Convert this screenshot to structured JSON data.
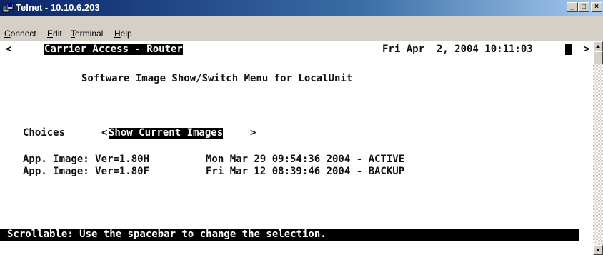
{
  "window": {
    "title": "Telnet - 10.10.6.203",
    "controls": {
      "minimize": "_",
      "maximize": "□",
      "close": "×"
    }
  },
  "menu": {
    "items": [
      {
        "label": "Connect",
        "underline": "C",
        "rest": "onnect"
      },
      {
        "label": "Edit",
        "underline": "E",
        "rest": "dit"
      },
      {
        "label": "Terminal",
        "underline": "T",
        "rest": "erminal"
      },
      {
        "label": "Help",
        "underline": "H",
        "rest": "elp"
      }
    ]
  },
  "terminal": {
    "left_arrow": "<",
    "right_arrow": ">",
    "header_title": "Carrier Access - Router",
    "datetime": "Fri Apr  2, 2004 10:11:03",
    "menu_title": "Software Image Show/Switch Menu for LocalUnit",
    "choices_label": "Choices",
    "choice_open": "<",
    "choice_selected": "Show Current Images",
    "choice_close": ">",
    "images": [
      {
        "label": "App. Image: Ver=1.80H",
        "info": "Mon Mar 29 09:54:36 2004 - ACTIVE"
      },
      {
        "label": "App. Image: Ver=1.80F",
        "info": "Fri Mar 12 08:39:46 2004 - BACKUP"
      }
    ],
    "status_bar": "Scrollable: Use the spacebar to change the selection."
  },
  "colors": {
    "titlebar_start": "#0a246a",
    "titlebar_end": "#a6caf0",
    "window_face": "#d4d0c8",
    "terminal_bg": "#ffffff",
    "terminal_text": "#111111",
    "inverse_bg": "#000000"
  },
  "icons": {
    "title": "telnet-app-icon",
    "scroll_up": "scroll-up-arrow-icon",
    "scroll_down": "scroll-down-arrow-icon"
  }
}
